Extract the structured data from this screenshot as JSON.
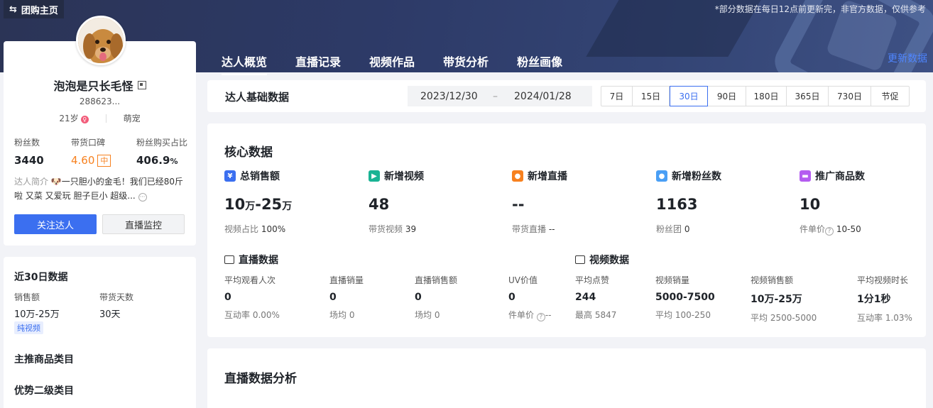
{
  "header": {
    "back_label": "团购主页",
    "disclaimer": "*部分数据在每日12点前更新完，非官方数据，仅供参考",
    "update_label": "更新数据",
    "tabs": [
      {
        "label": "达人概览",
        "active": true
      },
      {
        "label": "直播记录",
        "active": false
      },
      {
        "label": "视频作品",
        "active": false
      },
      {
        "label": "带货分析",
        "active": false
      },
      {
        "label": "粉丝画像",
        "active": false
      }
    ]
  },
  "profile": {
    "name": "泡泡是只长毛怪",
    "uid": "288623...",
    "age": "21岁",
    "category": "萌宠",
    "stats": [
      {
        "label": "粉丝数",
        "value": "3440"
      },
      {
        "label": "带货口碑",
        "value": "4.60",
        "badge": "中"
      },
      {
        "label": "粉丝购买占比",
        "value": "406.9",
        "unit": "%"
      }
    ],
    "intro_label": "达人简介",
    "intro_text": "🐶一只胆小的金毛！我们已经80斤啦 又菜 又爱玩 胆子巨小 超级...",
    "follow_label": "关注达人",
    "monitor_label": "直播监控"
  },
  "recent": {
    "title": "近30日数据",
    "sales_label": "销售额",
    "days_label": "带货天数",
    "sales_value": "10万-25万",
    "days_value": "30天",
    "tag": "纯视频",
    "main_category_title": "主推商品类目",
    "sub_category_title": "优势二级类目"
  },
  "basic": {
    "title": "达人基础数据",
    "date_start": "2023/12/30",
    "date_sep": "–",
    "date_end": "2024/01/28",
    "periods": [
      {
        "label": "7日",
        "active": false
      },
      {
        "label": "15日",
        "active": false
      },
      {
        "label": "30日",
        "active": true
      },
      {
        "label": "90日",
        "active": false
      },
      {
        "label": "180日",
        "active": false
      },
      {
        "label": "365日",
        "active": false
      },
      {
        "label": "730日",
        "active": false
      },
      {
        "label": "节促",
        "active": false
      }
    ]
  },
  "core": {
    "title": "核心数据",
    "metrics": [
      {
        "label": "总销售额",
        "value_a": "10",
        "unit_a": "万",
        "value_b": "-25",
        "unit_b": "万",
        "sub_label": "视频占比",
        "sub_value": "100%",
        "icon": "yen-icon",
        "color": "#3b6ff0"
      },
      {
        "label": "新增视频",
        "value_a": "48",
        "sub_label": "带货视频",
        "sub_value": "39",
        "icon": "video-play-icon",
        "color": "#19b394"
      },
      {
        "label": "新增直播",
        "value_a": "--",
        "sub_label": "带货直播",
        "sub_value": "--",
        "icon": "live-camera-icon",
        "color": "#f7811f"
      },
      {
        "label": "新增粉丝数",
        "value_a": "1163",
        "sub_label": "粉丝团",
        "sub_value": "0",
        "icon": "user-icon",
        "color": "#4a9ff5"
      },
      {
        "label": "推广商品数",
        "value_a": "10",
        "sub_label": "件单价",
        "sub_value": "10-50",
        "icon": "bag-icon",
        "color": "#b45cf0"
      }
    ],
    "live_title": "直播数据",
    "live_metrics": [
      {
        "label": "平均观看人次",
        "value": "0",
        "sub": "互动率 0.00%"
      },
      {
        "label": "直播销量",
        "value": "0",
        "sub": "场均 0"
      },
      {
        "label": "直播销售额",
        "value": "0",
        "sub": "场均 0"
      },
      {
        "label": "UV价值",
        "value": "0",
        "sub": "件单价",
        "sub_value": "--"
      }
    ],
    "video_title": "视频数据",
    "video_metrics": [
      {
        "label": "平均点赞",
        "value": "244",
        "sub": "最高 5847"
      },
      {
        "label": "视频销量",
        "value": "5000-7500",
        "sub": "平均 100-250"
      },
      {
        "label": "视频销售额",
        "value": "10万-25万",
        "sub": "平均 2500-5000"
      },
      {
        "label": "平均视频时长",
        "value": "1分1秒",
        "sub": "互动率 1.03%"
      }
    ]
  },
  "live_analysis": {
    "title": "直播数据分析"
  }
}
